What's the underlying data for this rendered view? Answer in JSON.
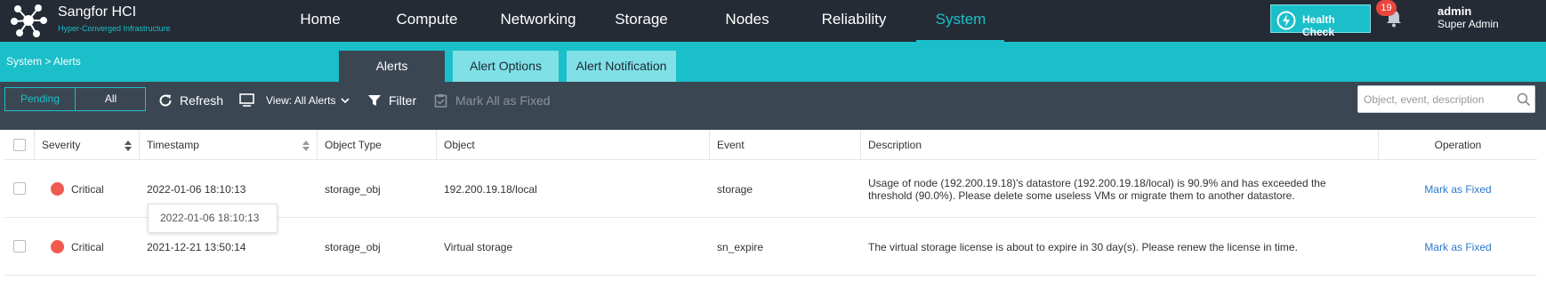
{
  "brand": {
    "title": "Sangfor HCI",
    "subtitle": "Hyper-Converged Infrastructure"
  },
  "nav": {
    "items": [
      {
        "label": "Home"
      },
      {
        "label": "Compute"
      },
      {
        "label": "Networking"
      },
      {
        "label": "Storage"
      },
      {
        "label": "Nodes"
      },
      {
        "label": "Reliability"
      },
      {
        "label": "System"
      }
    ],
    "active": "System"
  },
  "header": {
    "health_check": "Health Check",
    "notification_count": "19",
    "user_name": "admin",
    "user_role": "Super Admin"
  },
  "breadcrumb": "System  > Alerts",
  "tabs": [
    {
      "label": "Alerts"
    },
    {
      "label": "Alert Options"
    },
    {
      "label": "Alert Notification"
    }
  ],
  "toolbar": {
    "filter_pending": "Pending",
    "filter_all": "All",
    "refresh": "Refresh",
    "view": "View: All Alerts",
    "filter": "Filter",
    "mark_all": "Mark All as Fixed",
    "search_placeholder": "Object, event, description"
  },
  "table": {
    "columns": [
      "Severity",
      "Timestamp",
      "Object Type",
      "Object",
      "Event",
      "Description",
      "Operation"
    ],
    "rows": [
      {
        "severity": "Critical",
        "timestamp": "2022-01-06 18:10:13",
        "object_type": "storage_obj",
        "object": "192.200.19.18/local",
        "event": "storage",
        "description": "Usage of node (192.200.19.18)'s datastore (192.200.19.18/local) is 90.9% and has exceeded the threshold (90.0%). Please delete some useless VMs or migrate them to another datastore.",
        "operation": "Mark as Fixed"
      },
      {
        "severity": "Critical",
        "timestamp": "2021-12-21 13:50:14",
        "object_type": "storage_obj",
        "object": "Virtual storage",
        "event": "sn_expire",
        "description": "The virtual storage license is about to expire in 30 day(s). Please renew the license in time.",
        "operation": "Mark as Fixed"
      }
    ]
  },
  "tooltip": "2022-01-06 18:10:13",
  "colors": {
    "accent": "#1bbfc9",
    "nav_bg": "#242b35",
    "toolbar_bg": "#3b4653",
    "critical": "#f05a50",
    "link": "#2b7ac7"
  }
}
